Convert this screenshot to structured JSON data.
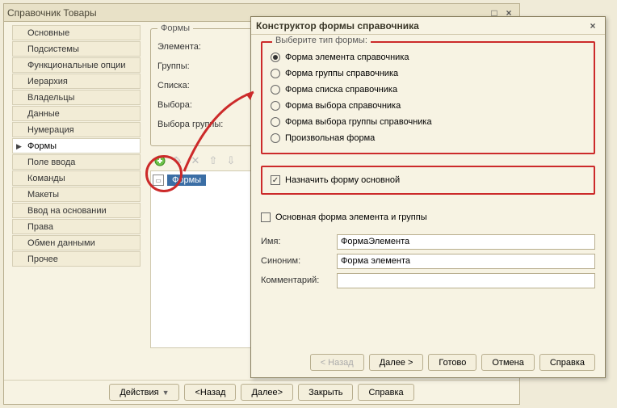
{
  "window": {
    "title": "Справочник Товары"
  },
  "sidebar": {
    "items": [
      "Основные",
      "Подсистемы",
      "Функциональные опции",
      "Иерархия",
      "Владельцы",
      "Данные",
      "Нумерация",
      "Формы",
      "Поле ввода",
      "Команды",
      "Макеты",
      "Ввод на основании",
      "Права",
      "Обмен данными",
      "Прочее"
    ],
    "active_index": 7
  },
  "forms_box": {
    "legend": "Формы",
    "labels": [
      "Элемента:",
      "Группы:",
      "Списка:",
      "Выбора:",
      "Выбора группы:"
    ]
  },
  "list": {
    "selected": "Формы"
  },
  "buttons": {
    "actions": "Действия",
    "back": "<Назад",
    "next": "Далее>",
    "close": "Закрыть",
    "help": "Справка"
  },
  "dialog": {
    "title": "Конструктор формы справочника",
    "group_legend": "Выберите тип формы:",
    "radios": [
      "Форма элемента справочника",
      "Форма группы справочника",
      "Форма списка справочника",
      "Форма выбора справочника",
      "Форма выбора группы справочника",
      "Произвольная форма"
    ],
    "radio_selected": 0,
    "assign_main": "Назначить форму основной",
    "main_form_check": "Основная форма элемента и группы",
    "name_label": "Имя:",
    "name_value": "ФормаЭлемента",
    "synonym_label": "Синоним:",
    "synonym_value": "Форма элемента",
    "comment_label": "Комментарий:",
    "comment_value": "",
    "btn_back": "< Назад",
    "btn_next": "Далее >",
    "btn_done": "Готово",
    "btn_cancel": "Отмена",
    "btn_help": "Справка"
  }
}
